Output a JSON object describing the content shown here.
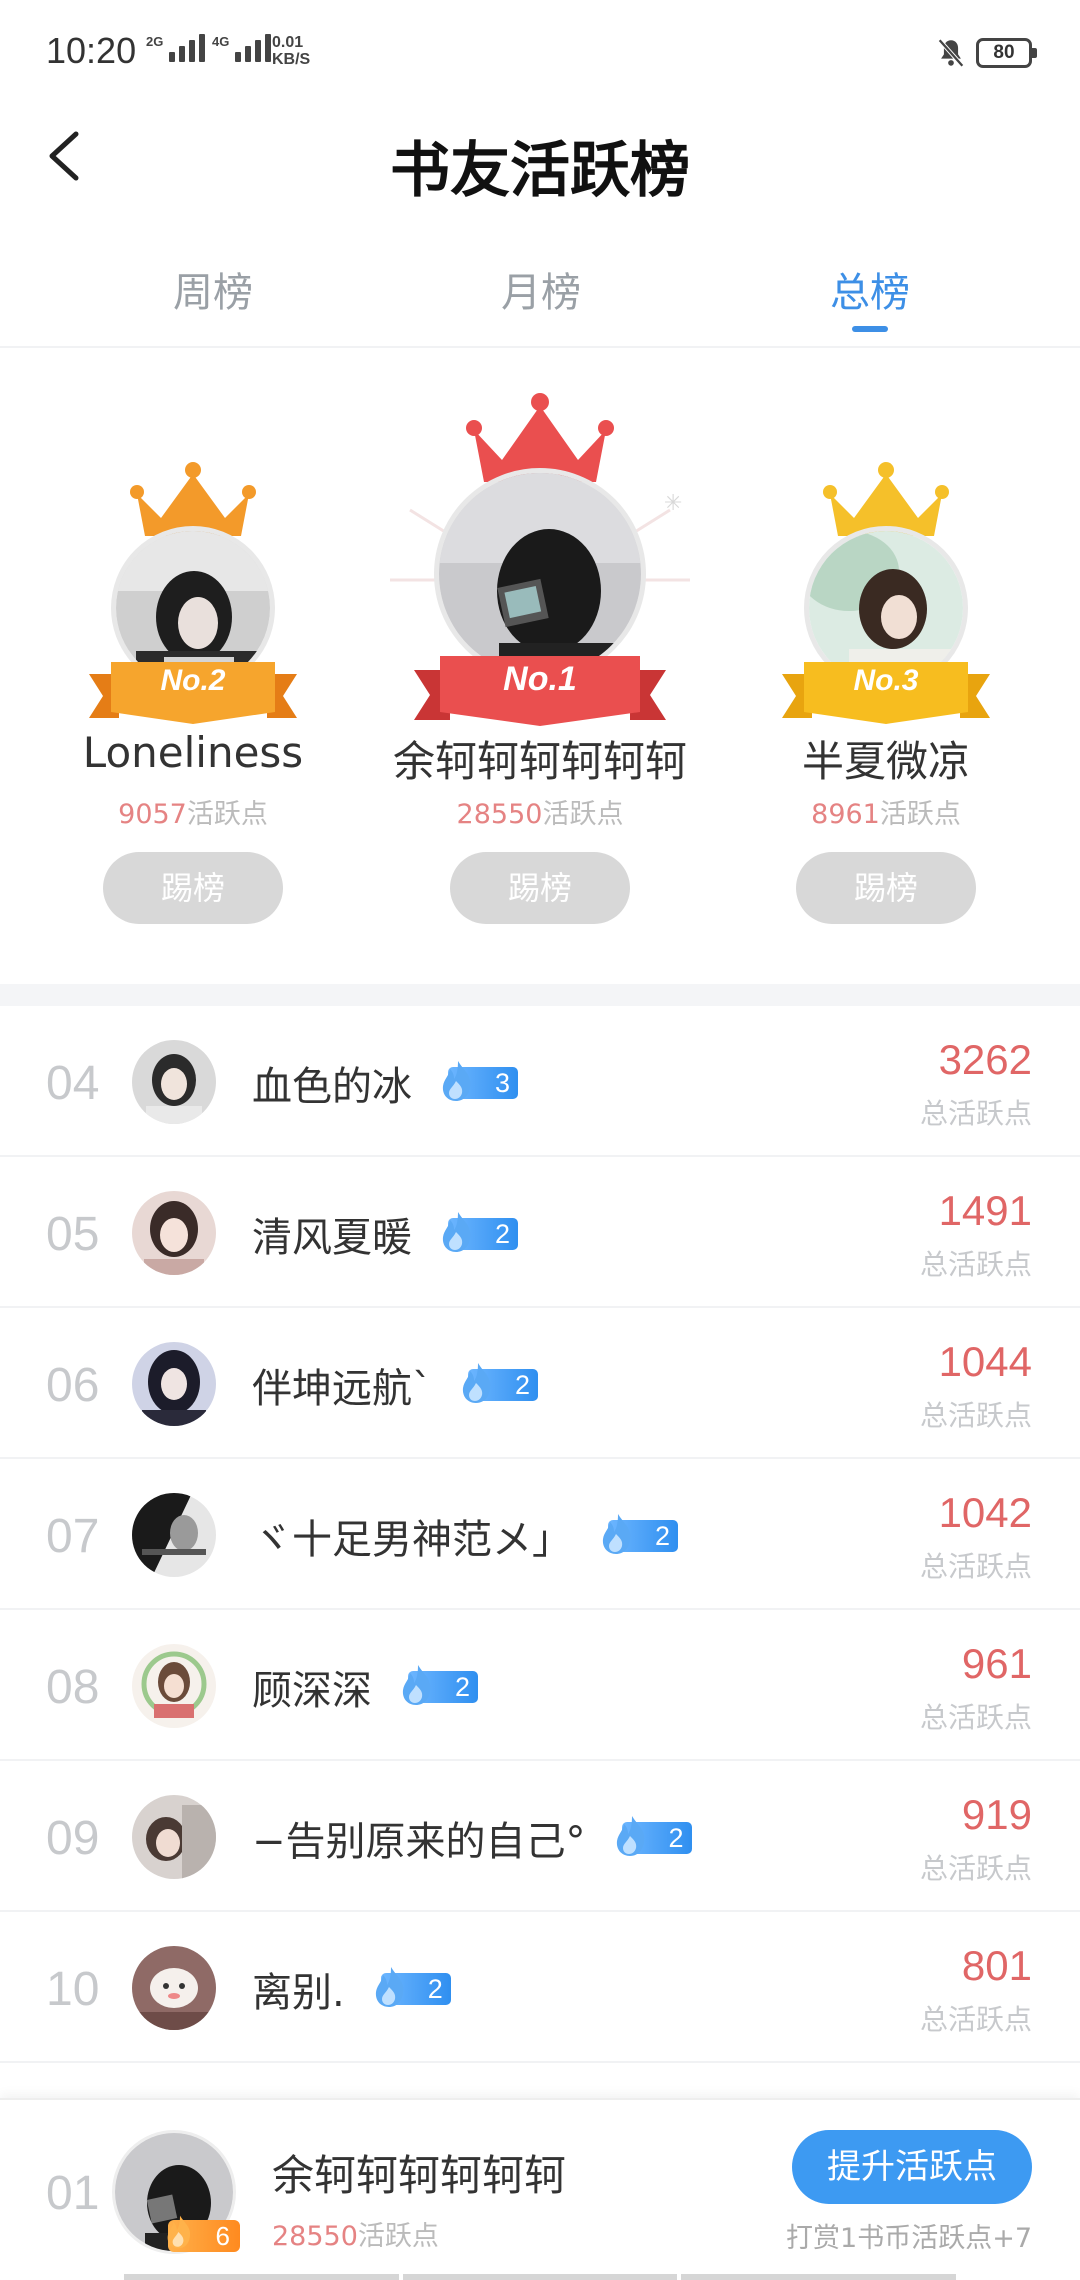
{
  "status_bar": {
    "time": "10:20",
    "signal1": "2G",
    "signal2": "4G",
    "speed_value": "0.01",
    "speed_unit": "KB/S",
    "battery": "80"
  },
  "header": {
    "title": "书友活跃榜"
  },
  "tabs": [
    {
      "label": "周榜",
      "active": false
    },
    {
      "label": "月榜",
      "active": false
    },
    {
      "label": "总榜",
      "active": true
    }
  ],
  "podium": {
    "first": {
      "badge": "No.1",
      "name": "余轲轲轲轲轲轲",
      "points": "28550",
      "points_unit": "活跃点",
      "button": "踢榜"
    },
    "second": {
      "badge": "No.2",
      "name": "Loneliness",
      "points": "9057",
      "points_unit": "活跃点",
      "button": "踢榜"
    },
    "third": {
      "badge": "No.3",
      "name": "半夏微凉",
      "points": "8961",
      "points_unit": "活跃点",
      "button": "踢榜"
    }
  },
  "list": [
    {
      "rank": "04",
      "name": "血色的冰",
      "level": "3",
      "score": "3262",
      "score_label": "总活跃点"
    },
    {
      "rank": "05",
      "name": "清风夏暖",
      "level": "2",
      "score": "1491",
      "score_label": "总活跃点"
    },
    {
      "rank": "06",
      "name": "伴坤远航`",
      "level": "2",
      "score": "1044",
      "score_label": "总活跃点"
    },
    {
      "rank": "07",
      "name": "ヾ十足男神范メ」",
      "level": "2",
      "score": "1042",
      "score_label": "总活跃点"
    },
    {
      "rank": "08",
      "name": "顾深深",
      "level": "2",
      "score": "961",
      "score_label": "总活跃点"
    },
    {
      "rank": "09",
      "name": "−告别原来的自己°",
      "level": "2",
      "score": "919",
      "score_label": "总活跃点"
    },
    {
      "rank": "10",
      "name": "离别.",
      "level": "2",
      "score": "801",
      "score_label": "总活跃点"
    }
  ],
  "me": {
    "rank": "01",
    "name": "余轲轲轲轲轲轲",
    "level": "6",
    "points": "28550",
    "points_unit": "活跃点",
    "boost_button": "提升活跃点",
    "tip": "打赏1书币活跃点+7"
  },
  "colors": {
    "accent": "#3d8fe6",
    "score": "#e06666",
    "gold": "#f5c02a",
    "silver_orange": "#f39a2a",
    "red": "#ea4f4f"
  }
}
